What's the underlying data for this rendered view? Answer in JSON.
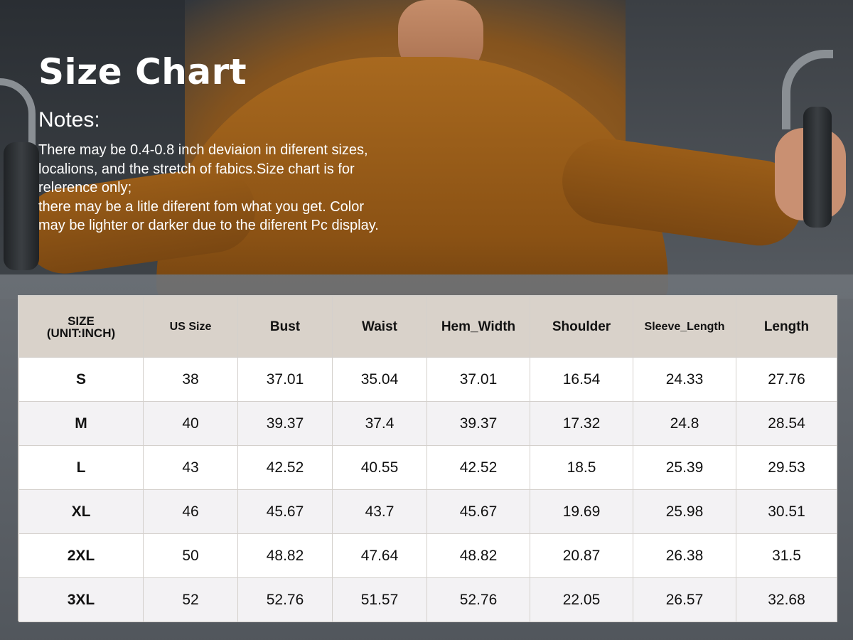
{
  "title": "Size Chart",
  "notes_heading": "Notes:",
  "notes_lines": [
    "There may be 0.4-0.8 inch deviaion in diferent sizes,",
    "localions, and the stretch of fabics.Size chart is for",
    "relerence only;",
    "there may be a litle diferent fom what you get. Color",
    "may be lighter or darker due to the diferent Pc display."
  ],
  "table": {
    "headers": {
      "size_line1": "SIZE",
      "size_line2": "(UNIT:INCH)",
      "us_size": "US Size",
      "bust": "Bust",
      "waist": "Waist",
      "hem_width": "Hem_Width",
      "shoulder": "Shoulder",
      "sleeve_length": "Sleeve_Length",
      "length": "Length"
    },
    "rows": [
      {
        "size": "S",
        "us": "38",
        "bust": "37.01",
        "waist": "35.04",
        "hem": "37.01",
        "shoulder": "16.54",
        "sleeve": "24.33",
        "length": "27.76"
      },
      {
        "size": "M",
        "us": "40",
        "bust": "39.37",
        "waist": "37.4",
        "hem": "39.37",
        "shoulder": "17.32",
        "sleeve": "24.8",
        "length": "28.54"
      },
      {
        "size": "L",
        "us": "43",
        "bust": "42.52",
        "waist": "40.55",
        "hem": "42.52",
        "shoulder": "18.5",
        "sleeve": "25.39",
        "length": "29.53"
      },
      {
        "size": "XL",
        "us": "46",
        "bust": "45.67",
        "waist": "43.7",
        "hem": "45.67",
        "shoulder": "19.69",
        "sleeve": "25.98",
        "length": "30.51"
      },
      {
        "size": "2XL",
        "us": "50",
        "bust": "48.82",
        "waist": "47.64",
        "hem": "48.82",
        "shoulder": "20.87",
        "sleeve": "26.38",
        "length": "31.5"
      },
      {
        "size": "3XL",
        "us": "52",
        "bust": "52.76",
        "waist": "51.57",
        "hem": "52.76",
        "shoulder": "22.05",
        "sleeve": "26.57",
        "length": "32.68"
      }
    ]
  },
  "colors": {
    "header_bg": "#d9d2ca",
    "alt_row_bg": "#f3f2f4",
    "shirt": "#a8691f"
  }
}
